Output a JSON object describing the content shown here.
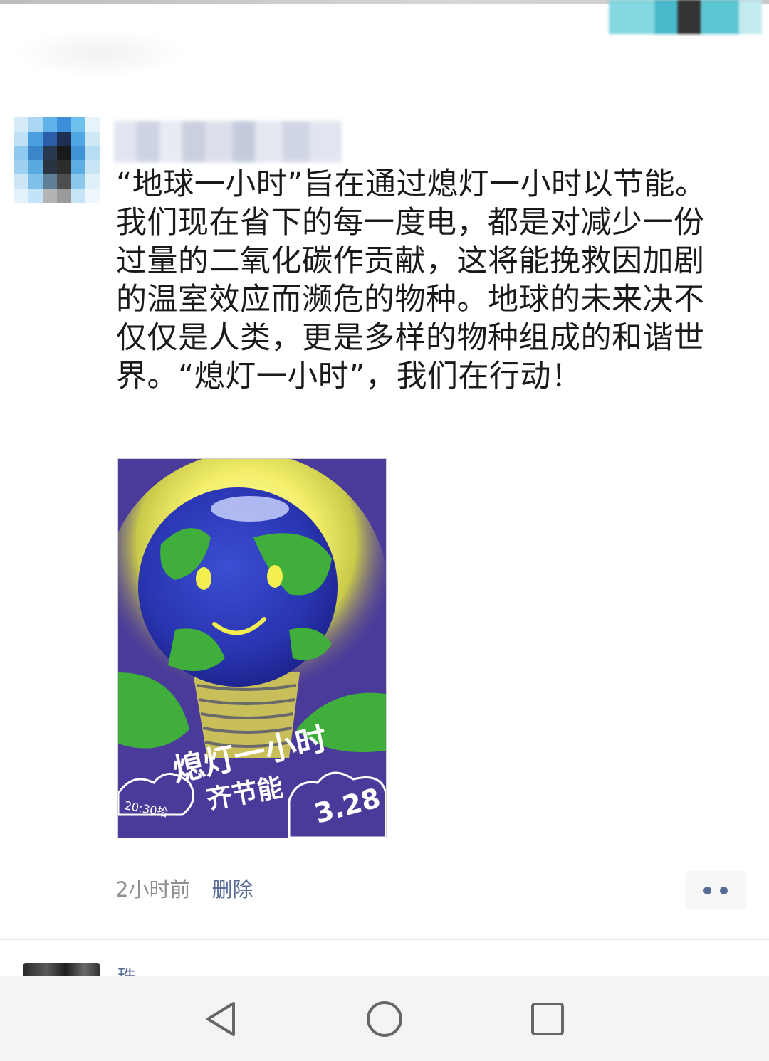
{
  "post": {
    "author_name": "",
    "text": "“地球一小时”旨在通过熄灯一小时以节能。我们现在省下的每一度电，都是对减少一份过量的二氧化碳作贡献，这将能挽救因加剧的温室效应而濒危的物种。地球的未来决不仅仅是人类，更是多样的物种组成的和谐世界。“熄灯一小时”，我们在行动！",
    "image": {
      "title_line1": "熄灯一小时",
      "title_line2": "齐节能",
      "time_label": "20:30拾",
      "date_label": "3.28"
    },
    "time_ago": "2小时前",
    "delete_label": "删除",
    "more_icon": "more-dots-icon"
  },
  "next_post": {
    "name_partial": "珠"
  },
  "navbar": {
    "back_icon": "back-triangle-icon",
    "home_icon": "home-circle-icon",
    "recents_icon": "recents-square-icon"
  },
  "colors": {
    "link": "#576b95",
    "meta": "#8e8e93",
    "text": "#1a1a1a",
    "poster_bg": "#4a3a9a"
  }
}
